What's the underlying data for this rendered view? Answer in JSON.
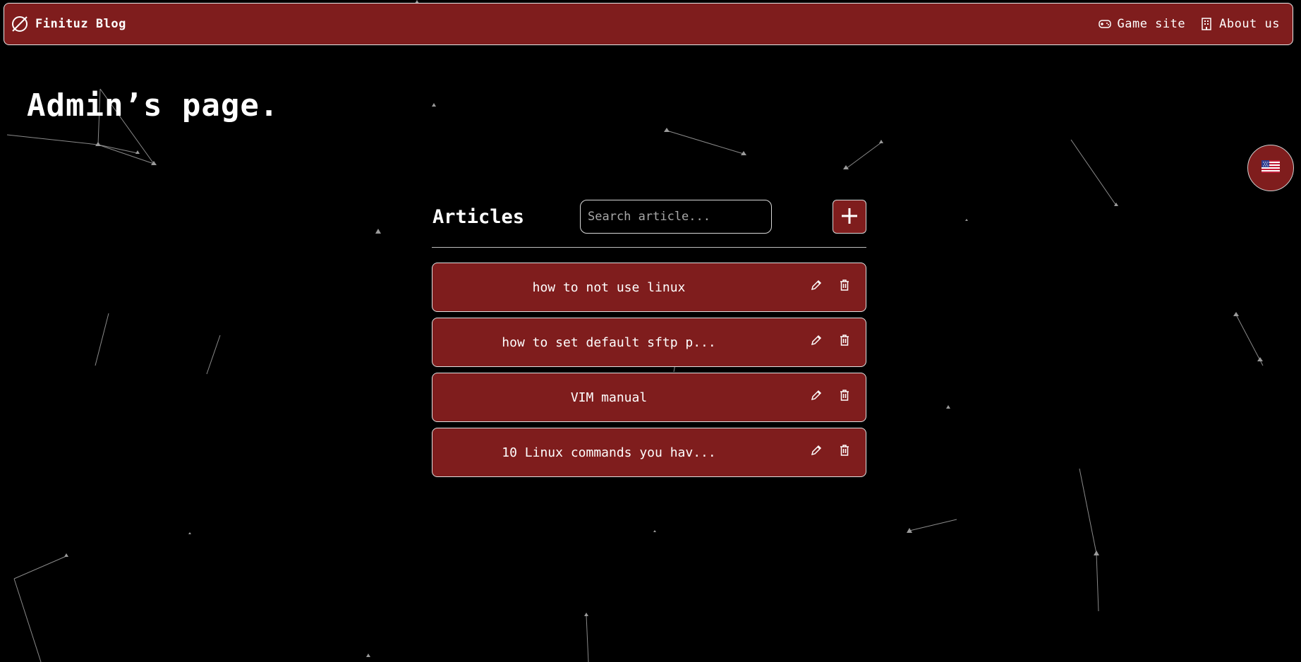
{
  "navbar": {
    "brand": "Finituz Blog",
    "links": [
      {
        "label": "Game site",
        "icon": "gamepad-icon"
      },
      {
        "label": "About us",
        "icon": "building-icon"
      }
    ]
  },
  "page_title": "Admin’s page.",
  "language": {
    "icon": "us-flag-icon"
  },
  "articles_section": {
    "title": "Articles",
    "search_placeholder": "Search article...",
    "add_icon": "plus-icon",
    "items": [
      {
        "title": "how to not use linux"
      },
      {
        "title": "how to set default sftp p..."
      },
      {
        "title": "VIM manual"
      },
      {
        "title": "10 Linux commands you hav..."
      }
    ],
    "edit_icon": "pencil-icon",
    "delete_icon": "trash-icon"
  },
  "colors": {
    "accent": "#7f1d1d",
    "background": "#000000",
    "border": "#e2e2e2",
    "text": "#ffffff"
  }
}
